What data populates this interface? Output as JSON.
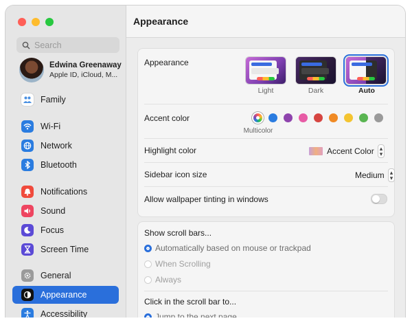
{
  "search": {
    "placeholder": "Search"
  },
  "profile": {
    "name": "Edwina Greenaway",
    "subtitle": "Apple ID, iCloud, M..."
  },
  "sidebar": {
    "items": [
      {
        "label": "Family",
        "icon": "family-icon",
        "color": "#ffffff"
      },
      {
        "label": "Wi-Fi",
        "icon": "wifi-icon",
        "color": "#2a7ce0"
      },
      {
        "label": "Network",
        "icon": "globe-icon",
        "color": "#2a7ce0"
      },
      {
        "label": "Bluetooth",
        "icon": "bluetooth-icon",
        "color": "#2a7ce0"
      },
      {
        "label": "Notifications",
        "icon": "bell-icon",
        "color": "#f04a3c"
      },
      {
        "label": "Sound",
        "icon": "speaker-icon",
        "color": "#ee4560"
      },
      {
        "label": "Focus",
        "icon": "moon-icon",
        "color": "#5b4ad6"
      },
      {
        "label": "Screen Time",
        "icon": "hourglass-icon",
        "color": "#5b4ad6"
      },
      {
        "label": "General",
        "icon": "gear-icon",
        "color": "#9a9a9a"
      },
      {
        "label": "Appearance",
        "icon": "appearance-icon",
        "color": "#111111"
      },
      {
        "label": "Accessibility",
        "icon": "accessibility-icon",
        "color": "#2a7ce0"
      }
    ]
  },
  "main": {
    "title": "Appearance",
    "appearance": {
      "label": "Appearance",
      "options": [
        "Light",
        "Dark",
        "Auto"
      ],
      "selected": "Auto"
    },
    "accent": {
      "label": "Accent color",
      "multicolor_label": "Multicolor",
      "colors": [
        "#2a7ce0",
        "#8e44ad",
        "#e75ba5",
        "#d64541",
        "#f08a24",
        "#f4c430",
        "#5ab552",
        "#9a9a9a"
      ]
    },
    "highlight": {
      "label": "Highlight color",
      "value": "Accent Color"
    },
    "sidebar_icon_size": {
      "label": "Sidebar icon size",
      "value": "Medium"
    },
    "wallpaper_tinting": {
      "label": "Allow wallpaper tinting in windows",
      "enabled": false
    },
    "scroll_bars": {
      "label": "Show scroll bars...",
      "options": [
        "Automatically based on mouse or trackpad",
        "When Scrolling",
        "Always"
      ],
      "selected": "Automatically based on mouse or trackpad"
    },
    "scroll_click": {
      "label": "Click in the scroll bar to...",
      "options": [
        "Jump to the next page"
      ],
      "selected": "Jump to the next page"
    }
  }
}
